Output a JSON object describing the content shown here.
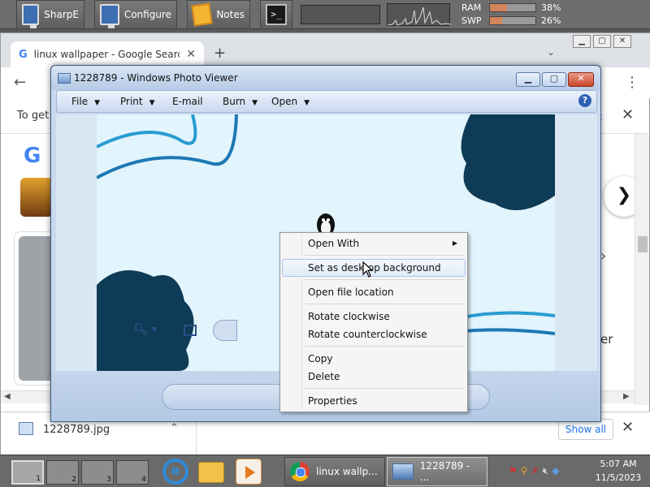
{
  "top_panel": {
    "launchers": [
      {
        "label": "SharpE",
        "icon": "monitor-icon"
      },
      {
        "label": "Configure",
        "icon": "monitor-icon"
      },
      {
        "label": "Notes",
        "icon": "notes-icon"
      }
    ],
    "terminal_glyph": ">_",
    "ram": {
      "label": "RAM",
      "value": "38%",
      "fraction": 0.38
    },
    "swp": {
      "label": "SWP",
      "value": "26%",
      "fraction": 0.26
    }
  },
  "browser": {
    "tab_title": "linux wallpaper - Google Search",
    "info_text": "To get",
    "info_link": "e",
    "google_letter": "G",
    "right_text": "er",
    "download_name": "1228789.jpg",
    "show_all": "Show all"
  },
  "photo_viewer": {
    "title": "1228789 - Windows Photo Viewer",
    "menus": [
      "File",
      "Print",
      "E-mail",
      "Burn",
      "Open"
    ],
    "context_menu": [
      {
        "label": "Open With",
        "submenu": true
      },
      {
        "label": "Set as desktop background",
        "hover": true
      },
      {
        "label": "Open file location"
      },
      {
        "label": "Rotate clockwise"
      },
      {
        "label": "Rotate counterclockwise"
      },
      {
        "label": "Copy"
      },
      {
        "label": "Delete"
      },
      {
        "label": "Properties"
      }
    ]
  },
  "taskbar": {
    "workspaces": [
      "1",
      "2",
      "3",
      "4"
    ],
    "tasks": [
      {
        "label": "linux wallp...",
        "icon": "chrome-icon"
      },
      {
        "label": "1228789 - ...",
        "icon": "photo-viewer-icon"
      }
    ],
    "clock_time": "5:07 AM",
    "clock_date": "11/5/2023"
  },
  "colors": {
    "wallpaper_bg": "#e2f4fc",
    "blob": "#0e3b55",
    "wave": "#2a9bd1"
  }
}
